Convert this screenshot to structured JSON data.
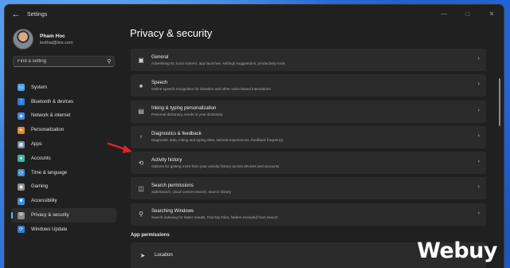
{
  "window": {
    "title": "Settings"
  },
  "profile": {
    "name": "Pham Hoc",
    "email": "lexthai@live.com"
  },
  "search": {
    "placeholder": "Find a setting"
  },
  "nav": {
    "items": [
      {
        "label": "System",
        "icon": "system-icon",
        "color": "#4aa3e8"
      },
      {
        "label": "Bluetooth & devices",
        "icon": "bluetooth-icon",
        "color": "#2f7fd6"
      },
      {
        "label": "Network & internet",
        "icon": "wifi-icon",
        "color": "#3d8ee0"
      },
      {
        "label": "Personalization",
        "icon": "brush-icon",
        "color": "#e08a3c"
      },
      {
        "label": "Apps",
        "icon": "apps-icon",
        "color": "#7a8ca6"
      },
      {
        "label": "Accounts",
        "icon": "person-icon",
        "color": "#3fb5a0"
      },
      {
        "label": "Time & language",
        "icon": "globe-clock-icon",
        "color": "#3b8fd8"
      },
      {
        "label": "Gaming",
        "icon": "gamepad-icon",
        "color": "#8f8f8f"
      },
      {
        "label": "Accessibility",
        "icon": "accessibility-icon",
        "color": "#3b8fd8"
      },
      {
        "label": "Privacy & security",
        "icon": "shield-icon",
        "color": "#8a8a8a"
      },
      {
        "label": "Windows Update",
        "icon": "update-icon",
        "color": "#2f7fd6"
      }
    ],
    "active_index": 9
  },
  "page": {
    "title": "Privacy & security"
  },
  "cards": [
    {
      "title": "General",
      "subtitle": "Advertising ID, local content, app launches, settings suggestions, productivity tools",
      "icon": "lock-icon"
    },
    {
      "title": "Speech",
      "subtitle": "Online speech recognition for dictation and other voice-based interactions",
      "icon": "speech-icon"
    },
    {
      "title": "Inking & typing personalization",
      "subtitle": "Personal dictionary, words in your dictionary",
      "icon": "clipboard-icon"
    },
    {
      "title": "Diagnostics & feedback",
      "subtitle": "Diagnostic data, inking and typing data, tailored experiences, feedback frequency",
      "icon": "diagnostics-icon"
    },
    {
      "title": "Activity history",
      "subtitle": "Options for getting more from your activity history across devices and accounts",
      "icon": "history-icon"
    },
    {
      "title": "Search permissions",
      "subtitle": "SafeSearch, cloud content search, search history",
      "icon": "search-permissions-icon"
    },
    {
      "title": "Searching Windows",
      "subtitle": "Search indexing for faster results, Find My Files, folders excluded from search",
      "icon": "search-windows-icon"
    }
  ],
  "app_permissions": {
    "heading": "App permissions",
    "items": [
      {
        "title": "Location",
        "icon": "location-icon"
      }
    ]
  },
  "watermark": "Webuy",
  "colors": {
    "accent": "#4cc2ff",
    "arrow": "#e0242a"
  }
}
